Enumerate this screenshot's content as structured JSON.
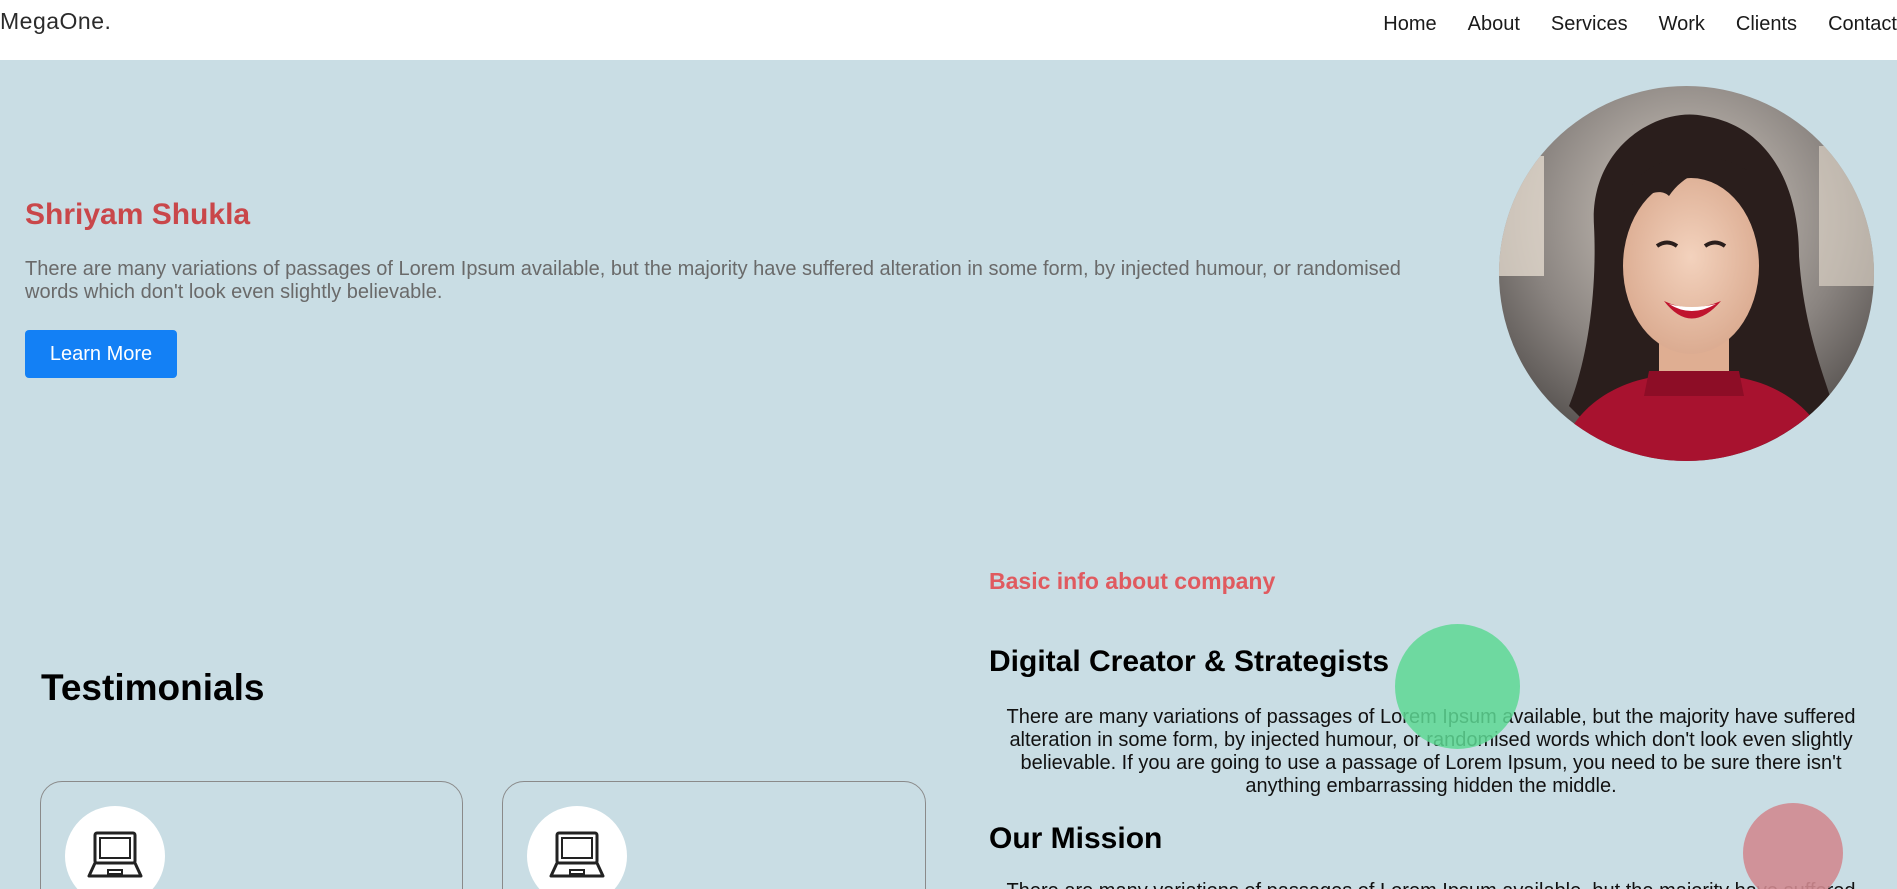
{
  "header": {
    "logo": "MegaOne.",
    "nav": [
      "Home",
      "About",
      "Services",
      "Work",
      "Clients",
      "Contact"
    ]
  },
  "hero": {
    "name": "Shriyam Shukla",
    "description": "There are many variations of passages of Lorem Ipsum available, but the majority have suffered alteration in some form, by injected humour, or randomised words which don't look even slightly believable.",
    "button_label": "Learn More",
    "button_color": "#1380f5",
    "name_color": "#c9474a"
  },
  "testimonials": {
    "title": "Testimonials",
    "cards": [
      {
        "icon": "laptop-icon"
      },
      {
        "icon": "laptop-icon"
      }
    ]
  },
  "company": {
    "kicker": "Basic info about company",
    "heading": "Digital Creator & Strategists",
    "text": "There are many variations of passages of Lorem Ipsum available, but the majority have suffered alteration in some form, by injected humour, or randomised words which don't look even slightly believable. If you are going to use a passage of Lorem Ipsum, you need to be sure there isn't anything embarrassing hidden the middle.",
    "mission_heading": "Our Mission",
    "mission_text": "There are many variations of passages of Lorem Ipsum available, but the majority have suffered"
  },
  "colors": {
    "background": "#c9dde4",
    "accent_red": "#e05a5f",
    "blob_green": "#5ed894",
    "blob_red": "#d08a90"
  }
}
